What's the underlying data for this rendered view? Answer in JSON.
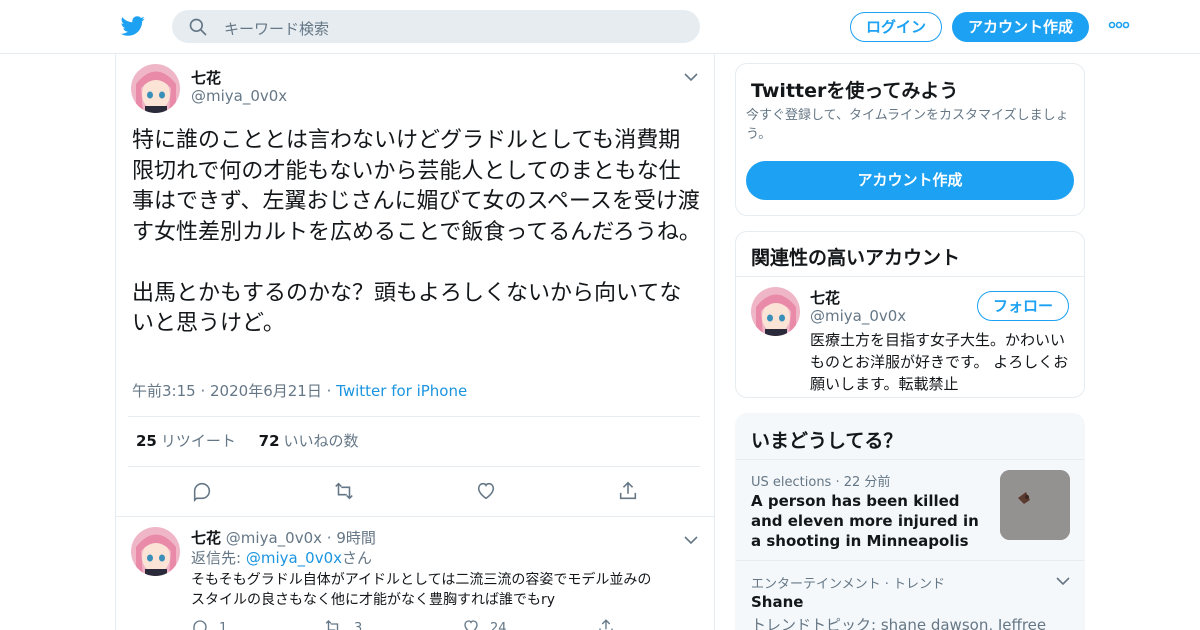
{
  "header": {
    "search_placeholder": "キーワード検索",
    "login_label": "ログイン",
    "signup_label": "アカウント作成"
  },
  "tweet": {
    "author_name": "七花",
    "author_handle": "@miya_0v0x",
    "text": "特に誰のこととは言わないけどグラドルとしても消費期限切れで何の才能もないから芸能人としてのまともな仕事はできず、左翼おじさんに媚びて女のスペースを受け渡す女性差別カルトを広めることで飯食ってるんだろうね。\n\n出馬とかもするのかな？頭もよろしくないから向いてないと思うけど。",
    "time": "午前3:15",
    "date": "2020年6月21日",
    "source": "Twitter for iPhone",
    "retweet_count": "25",
    "retweet_label": "リツイート",
    "like_count": "72",
    "like_label": "いいねの数"
  },
  "reply": {
    "author_name": "七花",
    "author_handle": "@miya_0v0x",
    "age": "9時間",
    "reply_to_prefix": "返信先: ",
    "reply_to_handle": "@miya_0v0x",
    "reply_to_suffix": "さん",
    "text_line1": "そもそもグラドル自体がアイドルとしては二流三流の容姿でモデル並みの",
    "text_line2": "スタイルの良さもなく他に才能がなく豊胸すれば誰でもry",
    "reply_count": "1",
    "retweet_count": "3",
    "like_count": "24"
  },
  "signup_card": {
    "title": "Twitterを使ってみよう",
    "description": "今すぐ登録して、タイムラインをカスタマイズしましょう。",
    "button": "アカウント作成"
  },
  "related_card": {
    "title": "関連性の高いアカウント",
    "name": "七花",
    "handle": "@miya_0v0x",
    "follow_label": "フォロー",
    "bio": "医療土方を目指す女子大生。かわいいものとお洋服が好きです。 よろしくお願いします。転載禁止"
  },
  "trends_card": {
    "title": "いまどうしてる？",
    "items": [
      {
        "category": "US elections",
        "age": "22 分前",
        "title": "A person has been killed and eleven more injured in a shooting in Minneapolis"
      },
      {
        "category": "エンターテインメント · トレンド",
        "title": "Shane",
        "subtitle": "トレンドトピック: shane dawson, Jeffree"
      }
    ]
  },
  "colors": {
    "accent": "#1da1f2",
    "link": "#1b95e0",
    "secondary_text": "#657786",
    "border": "#e6ecf0"
  },
  "icons": [
    "twitter-bird-icon",
    "search-icon",
    "more-dots-icon",
    "chevron-down-icon",
    "reply-icon",
    "retweet-icon",
    "like-icon",
    "share-icon"
  ]
}
